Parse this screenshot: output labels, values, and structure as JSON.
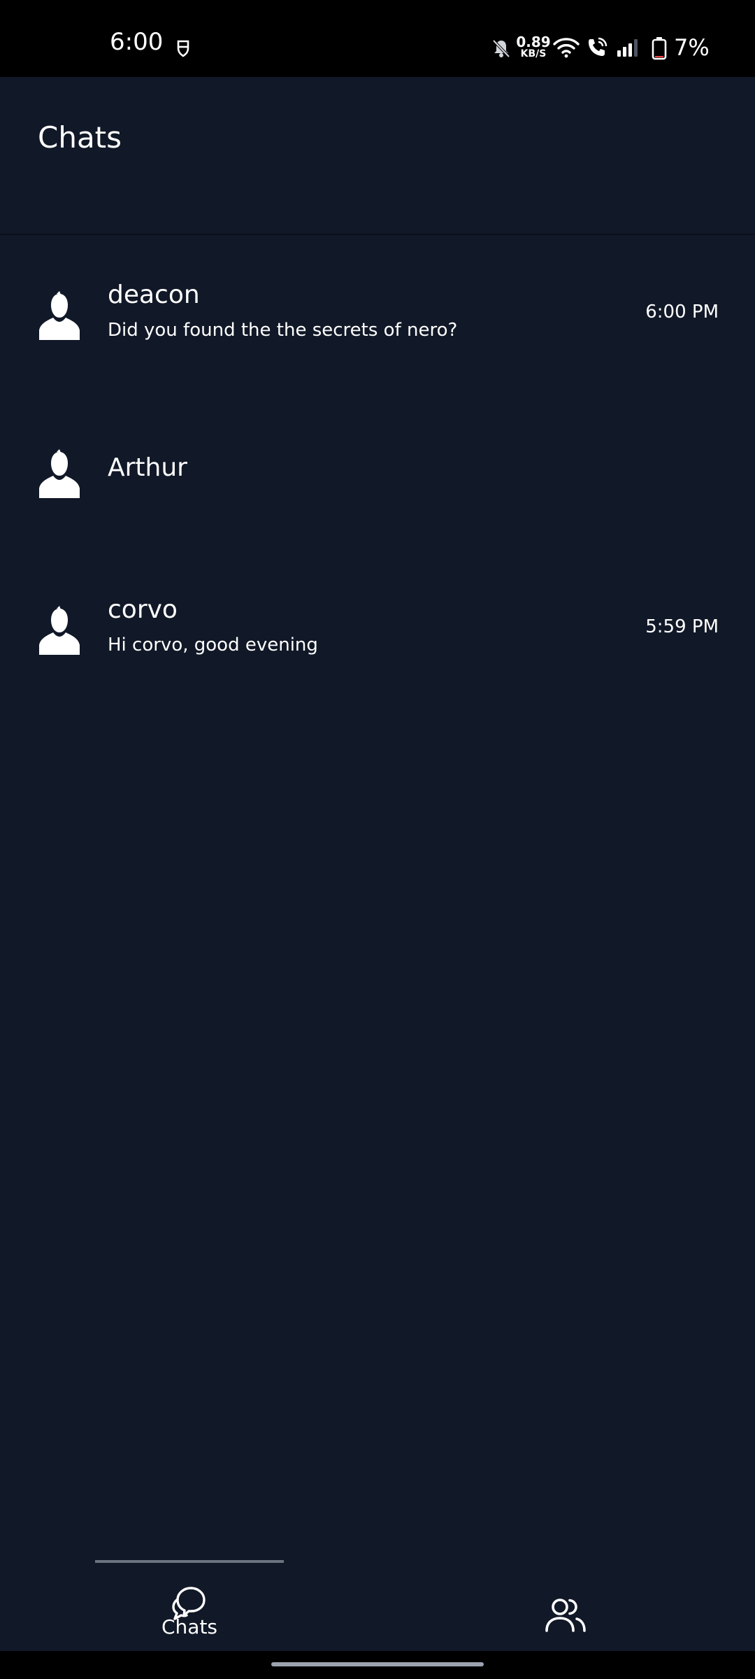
{
  "status_bar": {
    "time": "6:00",
    "net_speed_value": "0.89",
    "net_speed_unit": "KB/S",
    "battery_percent": "7%",
    "icons": [
      "notification-shield-icon",
      "bell-off-icon",
      "wifi-icon",
      "wifi-calling-icon",
      "signal-icon",
      "battery-icon"
    ]
  },
  "header": {
    "title": "Chats"
  },
  "chats": [
    {
      "name": "deacon",
      "preview": "Did you found the the secrets of nero?",
      "time": "6:00 PM"
    },
    {
      "name": "Arthur",
      "preview": "",
      "time": ""
    },
    {
      "name": "corvo",
      "preview": "Hi corvo, good evening",
      "time": "5:59 PM"
    }
  ],
  "bottom_nav": {
    "tabs": [
      {
        "label": "Chats",
        "icon": "chat-bubbles-icon",
        "active": true
      },
      {
        "label": "",
        "icon": "contacts-icon",
        "active": false
      }
    ]
  },
  "colors": {
    "background": "#111827",
    "status_bar": "#000000",
    "text": "#ffffff",
    "tab_indicator": "#6b7280"
  }
}
